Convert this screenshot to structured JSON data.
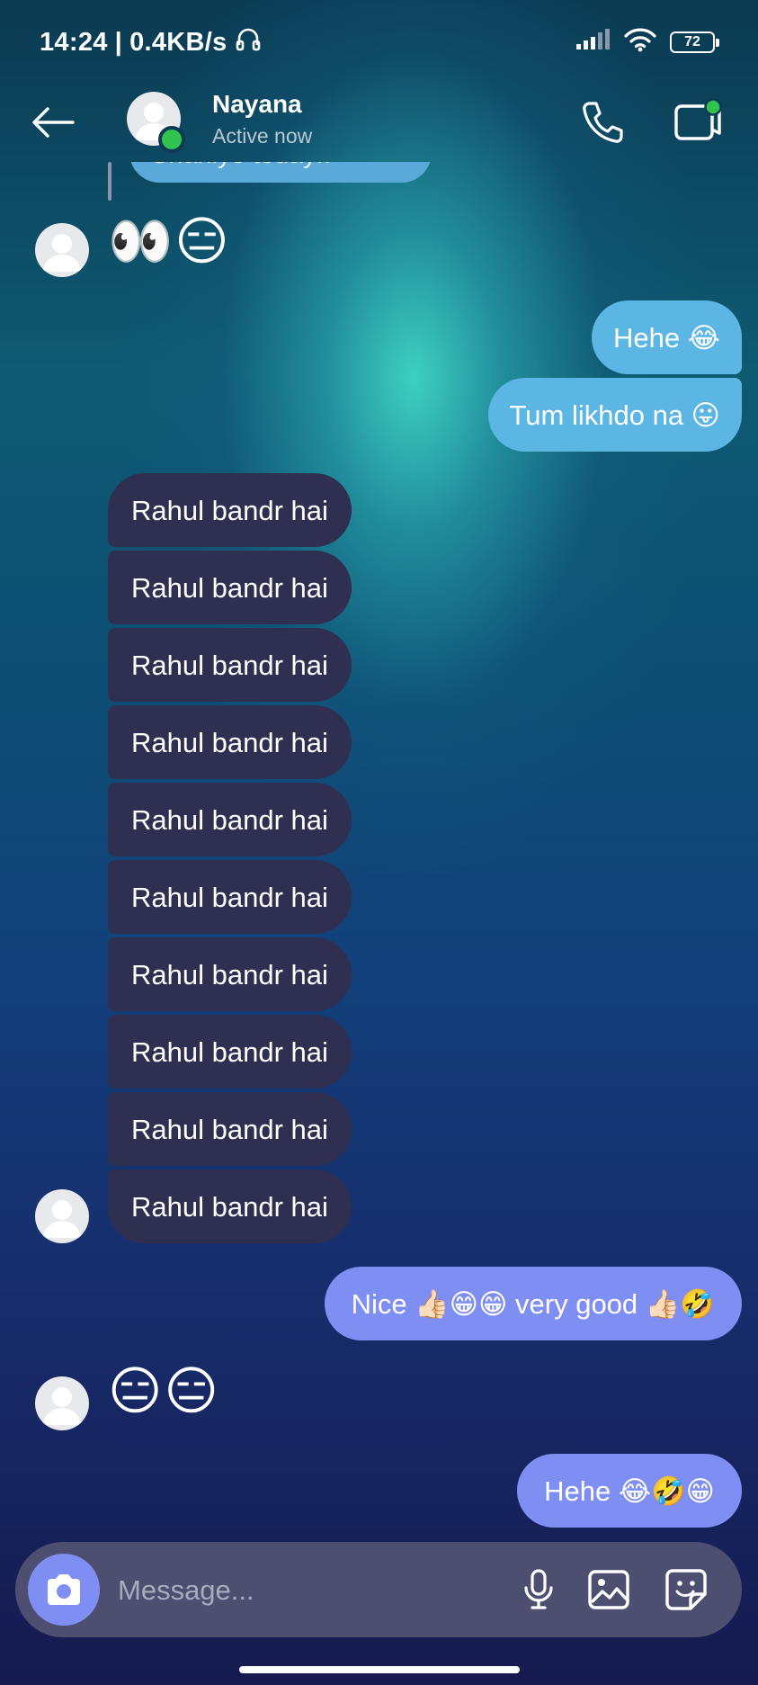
{
  "status_bar": {
    "time": "14:24",
    "network_speed": "0.4KB/s",
    "battery": "72"
  },
  "header": {
    "contact_name": "Nayana",
    "contact_status": "Active now"
  },
  "quoted_message": "Shahiye today!!",
  "messages": {
    "emoji_1": "👀😑",
    "hehe_1": "Hehe 😂",
    "tum": "Tum likhdo na 😛",
    "rahul": [
      "Rahul bandr hai",
      "Rahul bandr hai",
      "Rahul bandr hai",
      "Rahul bandr hai",
      "Rahul bandr hai",
      "Rahul bandr hai",
      "Rahul bandr hai",
      "Rahul bandr hai",
      "Rahul bandr hai",
      "Rahul bandr hai"
    ],
    "nice": "Nice 👍🏻😁😁 very good 👍🏻🤣",
    "emoji_2": "😑😑",
    "hehe_2": "Hehe 😂🤣😁"
  },
  "composer": {
    "placeholder": "Message..."
  },
  "colors": {
    "received_bubble": "#2f3051",
    "sent_bubble_cyan": "#5bb6e4",
    "sent_bubble_purple": "#7f8ef2",
    "online": "#32c24f",
    "input_bar": "#4d4f71"
  }
}
